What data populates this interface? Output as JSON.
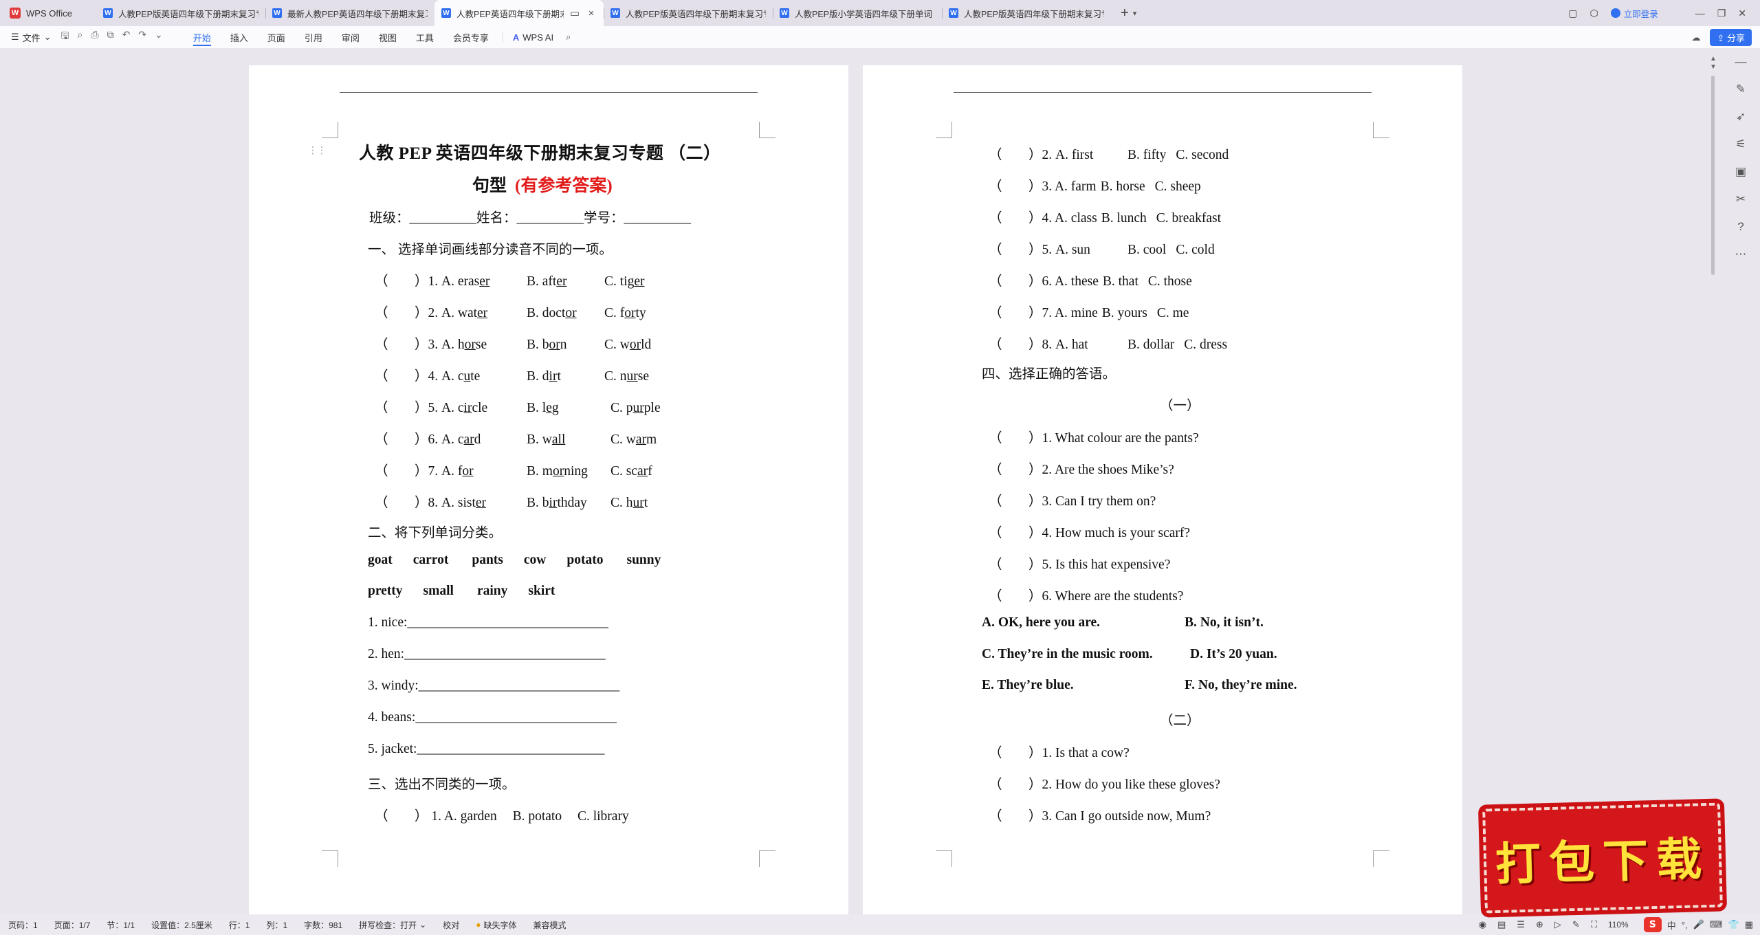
{
  "app": {
    "name": "WPS Office"
  },
  "tabs": [
    {
      "title": "人教PEP版英语四年级下册期末复习专",
      "active": false,
      "closable": false
    },
    {
      "title": "最新人教PEP英语四年级下册期末复习",
      "active": false,
      "closable": false
    },
    {
      "title": "人教PEP英语四年级下册期末",
      "active": true,
      "closable": true
    },
    {
      "title": "人教PEP版英语四年级下册期末复习专",
      "active": false,
      "closable": false
    },
    {
      "title": "人教PEP版小学英语四年级下册单词",
      "active": false,
      "closable": false
    },
    {
      "title": "人教PEP版英语四年级下册期末复习专",
      "active": false,
      "closable": false
    }
  ],
  "titlebar": {
    "login_label": "立即登录"
  },
  "ribbon": {
    "file_label": "文件",
    "tabs": [
      "开始",
      "插入",
      "页面",
      "引用",
      "审阅",
      "视图",
      "工具",
      "会员专享"
    ],
    "active_tab": "开始",
    "ai_label": "WPS AI",
    "share_label": "分享"
  },
  "document": {
    "title": "人教 PEP 英语四年级下册期末复习专题 （二）",
    "subtitle": "句型",
    "subtitle_note": "(有参考答案)",
    "info_line": "班级：__________姓名：__________学号：__________",
    "section1": "一、 选择单词画线部分读音不同的一项。",
    "q1": [
      {
        "n": "1.",
        "a": [
          "A.",
          "eras",
          "er"
        ],
        "b": [
          "B.",
          "aft",
          "er"
        ],
        "c": [
          "C.",
          "tig",
          "er"
        ]
      },
      {
        "n": "2.",
        "a": [
          "A.",
          "wat",
          "er"
        ],
        "b": [
          "B.",
          "doct",
          "or"
        ],
        "c": [
          "C.",
          "f",
          "or",
          "ty"
        ]
      },
      {
        "n": "3.",
        "a": [
          "A.",
          "h",
          "or",
          "se"
        ],
        "b": [
          "B.",
          "b",
          "or",
          "n"
        ],
        "c": [
          "C.",
          "w",
          "or",
          "ld"
        ]
      },
      {
        "n": "4.",
        "a": [
          "A.",
          "c",
          "u",
          "te"
        ],
        "b": [
          "B.",
          "d",
          "ir",
          "t"
        ],
        "c": [
          "C.",
          "n",
          "ur",
          "se"
        ]
      },
      {
        "n": "5.",
        "a": [
          "A.",
          "c",
          "ir",
          "cle"
        ],
        "b": [
          "B.",
          "l",
          "e",
          "g"
        ],
        "c": [
          "C.",
          "p",
          "ur",
          "ple"
        ]
      },
      {
        "n": "6.",
        "a": [
          "A.",
          "c",
          "ar",
          "d"
        ],
        "b": [
          "B.",
          "w",
          "all",
          ""
        ],
        "c": [
          "C.",
          "w",
          "ar",
          "m"
        ]
      },
      {
        "n": "7.",
        "a": [
          "A.",
          "f",
          "or",
          ""
        ],
        "b": [
          "B.",
          "m",
          "or",
          "ning"
        ],
        "c": [
          "C.",
          "sc",
          "ar",
          "f"
        ]
      },
      {
        "n": "8.",
        "a": [
          "A.",
          "sist",
          "er",
          ""
        ],
        "b": [
          "B.",
          "b",
          "ir",
          "thday"
        ],
        "c": [
          "C.",
          "h",
          "ur",
          "t"
        ]
      }
    ],
    "section2": "二、将下列单词分类。",
    "words_row1": [
      "goat",
      "carrot",
      "pants",
      "cow",
      "potato",
      "sunny"
    ],
    "words_row2": [
      "pretty",
      "small",
      "rainy",
      "skirt"
    ],
    "fill_lines": [
      "1. nice:______________________________",
      "2. hen:______________________________",
      "3. windy:______________________________",
      "4. beans:______________________________",
      "5. jacket:____________________________"
    ],
    "section3": "三、选出不同类的一项。",
    "q3_first": {
      "n": "1.",
      "a": "A. garden",
      "b": "B. potato",
      "c": "C. library"
    },
    "q3_rest": [
      {
        "n": "2.",
        "a": "A. first",
        "b": "B. fifty",
        "c": "C. second"
      },
      {
        "n": "3.",
        "a": "A. farm",
        "b": "B. horse",
        "c": "C. sheep"
      },
      {
        "n": "4.",
        "a": "A. class",
        "b": "B. lunch",
        "c": "C. breakfast"
      },
      {
        "n": "5.",
        "a": "A. sun",
        "b": "B. cool",
        "c": "C. cold"
      },
      {
        "n": "6.",
        "a": "A. these",
        "b": "B. that",
        "c": "C. those"
      },
      {
        "n": "7.",
        "a": "A. mine",
        "b": "B. yours",
        "c": "C. me"
      },
      {
        "n": "8.",
        "a": "A. hat",
        "b": "B. dollar",
        "c": "C. dress"
      }
    ],
    "section4": "四、选择正确的答语。",
    "part1_label": "（一）",
    "q4_part1": [
      "1. What colour are the pants?",
      "2. Are the shoes Mike’s?",
      "3. Can I try them on?",
      "4. How much is your scarf?",
      "5. Is this hat expensive?",
      "6. Where are the students?"
    ],
    "answers": [
      "A. OK, here you are.",
      "B. No, it isn’t.",
      "C. They’re in the music room.",
      "D. It’s 20 yuan.",
      "E. They’re blue.",
      "F. No, they’re mine."
    ],
    "part2_label": "（二）",
    "q4_part2": [
      "1. Is that a cow?",
      "2. How do you like these gloves?",
      "3. Can I go outside now, Mum?"
    ],
    "paren_open": "（",
    "paren_close": "）"
  },
  "status": {
    "page": "页码：1",
    "pages": "页面：1/7",
    "section": "节：1/1",
    "setting": "设置值：2.5厘米",
    "row": "行：1",
    "col": "列：1",
    "wordcount": "字数：981",
    "spellcheck": "拼写检查：打开",
    "proofread": "校对",
    "missing_font": "缺失字体",
    "compat": "兼容模式",
    "zoom": "110%"
  },
  "tray": {
    "ime_char": "中"
  },
  "banner": {
    "text": "打包下载"
  }
}
